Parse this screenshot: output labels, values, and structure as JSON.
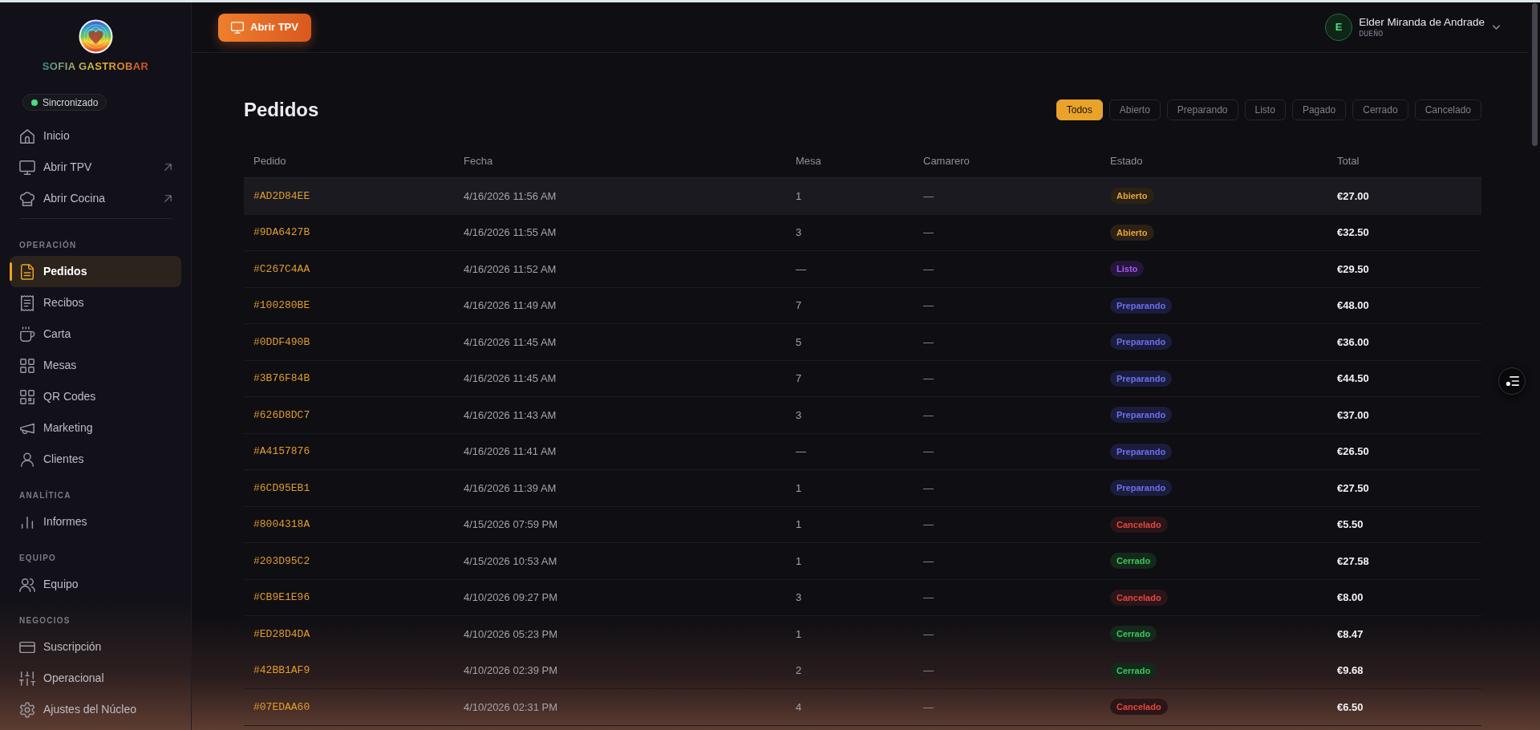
{
  "sidebar": {
    "brand": "SOFIA GASTROBAR",
    "sync_status": "Sincronizado",
    "top_items": [
      {
        "label": "Inicio",
        "external": false,
        "selected": false
      },
      {
        "label": "Abrir TPV",
        "external": true,
        "selected": false
      },
      {
        "label": "Abrir Cocina",
        "external": true,
        "selected": false
      }
    ],
    "sections": [
      {
        "heading": "OPERACIÓN",
        "items": [
          {
            "label": "Pedidos",
            "selected": true
          },
          {
            "label": "Recibos",
            "selected": false
          },
          {
            "label": "Carta",
            "selected": false
          },
          {
            "label": "Mesas",
            "selected": false
          },
          {
            "label": "QR Codes",
            "selected": false
          },
          {
            "label": "Marketing",
            "selected": false
          },
          {
            "label": "Clientes",
            "selected": false
          }
        ]
      },
      {
        "heading": "ANALÍTICA",
        "items": [
          {
            "label": "Informes",
            "selected": false
          }
        ]
      },
      {
        "heading": "EQUIPO",
        "items": [
          {
            "label": "Equipo",
            "selected": false
          }
        ]
      },
      {
        "heading": "NEGOCIOS",
        "items": [
          {
            "label": "Suscripción",
            "selected": false
          },
          {
            "label": "Operacional",
            "selected": false
          },
          {
            "label": "Ajustes del Núcleo",
            "selected": false
          }
        ]
      }
    ]
  },
  "topbar": {
    "button": "Abrir TPV",
    "user": {
      "initial": "E",
      "name": "Elder Miranda de Andrade",
      "role": "DUEÑO"
    }
  },
  "page": {
    "title": "Pedidos",
    "filters": [
      {
        "label": "Todos",
        "selected": true
      },
      {
        "label": "Abierto",
        "selected": false
      },
      {
        "label": "Preparando",
        "selected": false
      },
      {
        "label": "Listo",
        "selected": false
      },
      {
        "label": "Pagado",
        "selected": false
      },
      {
        "label": "Cerrado",
        "selected": false
      },
      {
        "label": "Cancelado",
        "selected": false
      }
    ]
  },
  "table": {
    "columns": [
      "Pedido",
      "Fecha",
      "Mesa",
      "Camarero",
      "Estado",
      "Total"
    ],
    "rows": [
      {
        "id": "#AD2D84EE",
        "date": "4/16/2026 11:56 AM",
        "table_number": "1",
        "waiter": "—",
        "status": {
          "label": "Abierto",
          "kind": "open"
        },
        "total": "€27.00",
        "highlighted": true
      },
      {
        "id": "#9DA6427B",
        "date": "4/16/2026 11:55 AM",
        "table_number": "3",
        "waiter": "—",
        "status": {
          "label": "Abierto",
          "kind": "open"
        },
        "total": "€32.50",
        "highlighted": false
      },
      {
        "id": "#C267C4AA",
        "date": "4/16/2026 11:52 AM",
        "table_number": "—",
        "waiter": "—",
        "status": {
          "label": "Listo",
          "kind": "ready"
        },
        "total": "€29.50",
        "highlighted": false
      },
      {
        "id": "#100280BE",
        "date": "4/16/2026 11:49 AM",
        "table_number": "7",
        "waiter": "—",
        "status": {
          "label": "Preparando",
          "kind": "preparing"
        },
        "total": "€48.00",
        "highlighted": false
      },
      {
        "id": "#0DDF490B",
        "date": "4/16/2026 11:45 AM",
        "table_number": "5",
        "waiter": "—",
        "status": {
          "label": "Preparando",
          "kind": "preparing"
        },
        "total": "€36.00",
        "highlighted": false
      },
      {
        "id": "#3B76F84B",
        "date": "4/16/2026 11:45 AM",
        "table_number": "7",
        "waiter": "—",
        "status": {
          "label": "Preparando",
          "kind": "preparing"
        },
        "total": "€44.50",
        "highlighted": false
      },
      {
        "id": "#626D8DC7",
        "date": "4/16/2026 11:43 AM",
        "table_number": "3",
        "waiter": "—",
        "status": {
          "label": "Preparando",
          "kind": "preparing"
        },
        "total": "€37.00",
        "highlighted": false
      },
      {
        "id": "#A4157876",
        "date": "4/16/2026 11:41 AM",
        "table_number": "—",
        "waiter": "—",
        "status": {
          "label": "Preparando",
          "kind": "preparing"
        },
        "total": "€26.50",
        "highlighted": false
      },
      {
        "id": "#6CD95EB1",
        "date": "4/16/2026 11:39 AM",
        "table_number": "1",
        "waiter": "—",
        "status": {
          "label": "Preparando",
          "kind": "preparing"
        },
        "total": "€27.50",
        "highlighted": false
      },
      {
        "id": "#8004318A",
        "date": "4/15/2026 07:59 PM",
        "table_number": "1",
        "waiter": "—",
        "status": {
          "label": "Cancelado",
          "kind": "cancelled"
        },
        "total": "€5.50",
        "highlighted": false
      },
      {
        "id": "#203D95C2",
        "date": "4/15/2026 10:53 AM",
        "table_number": "1",
        "waiter": "—",
        "status": {
          "label": "Cerrado",
          "kind": "closed"
        },
        "total": "€27.58",
        "highlighted": false
      },
      {
        "id": "#CB9E1E96",
        "date": "4/10/2026 09:27 PM",
        "table_number": "3",
        "waiter": "—",
        "status": {
          "label": "Cancelado",
          "kind": "cancelled"
        },
        "total": "€8.00",
        "highlighted": false
      },
      {
        "id": "#ED28D4DA",
        "date": "4/10/2026 05:23 PM",
        "table_number": "1",
        "waiter": "—",
        "status": {
          "label": "Cerrado",
          "kind": "closed"
        },
        "total": "€8.47",
        "highlighted": false
      },
      {
        "id": "#42BB1AF9",
        "date": "4/10/2026 02:39 PM",
        "table_number": "2",
        "waiter": "—",
        "status": {
          "label": "Cerrado",
          "kind": "closed"
        },
        "total": "€9.68",
        "highlighted": false
      },
      {
        "id": "#07EDAA60",
        "date": "4/10/2026 02:31 PM",
        "table_number": "4",
        "waiter": "—",
        "status": {
          "label": "Cancelado",
          "kind": "cancelled"
        },
        "total": "€6.50",
        "highlighted": false
      }
    ]
  }
}
